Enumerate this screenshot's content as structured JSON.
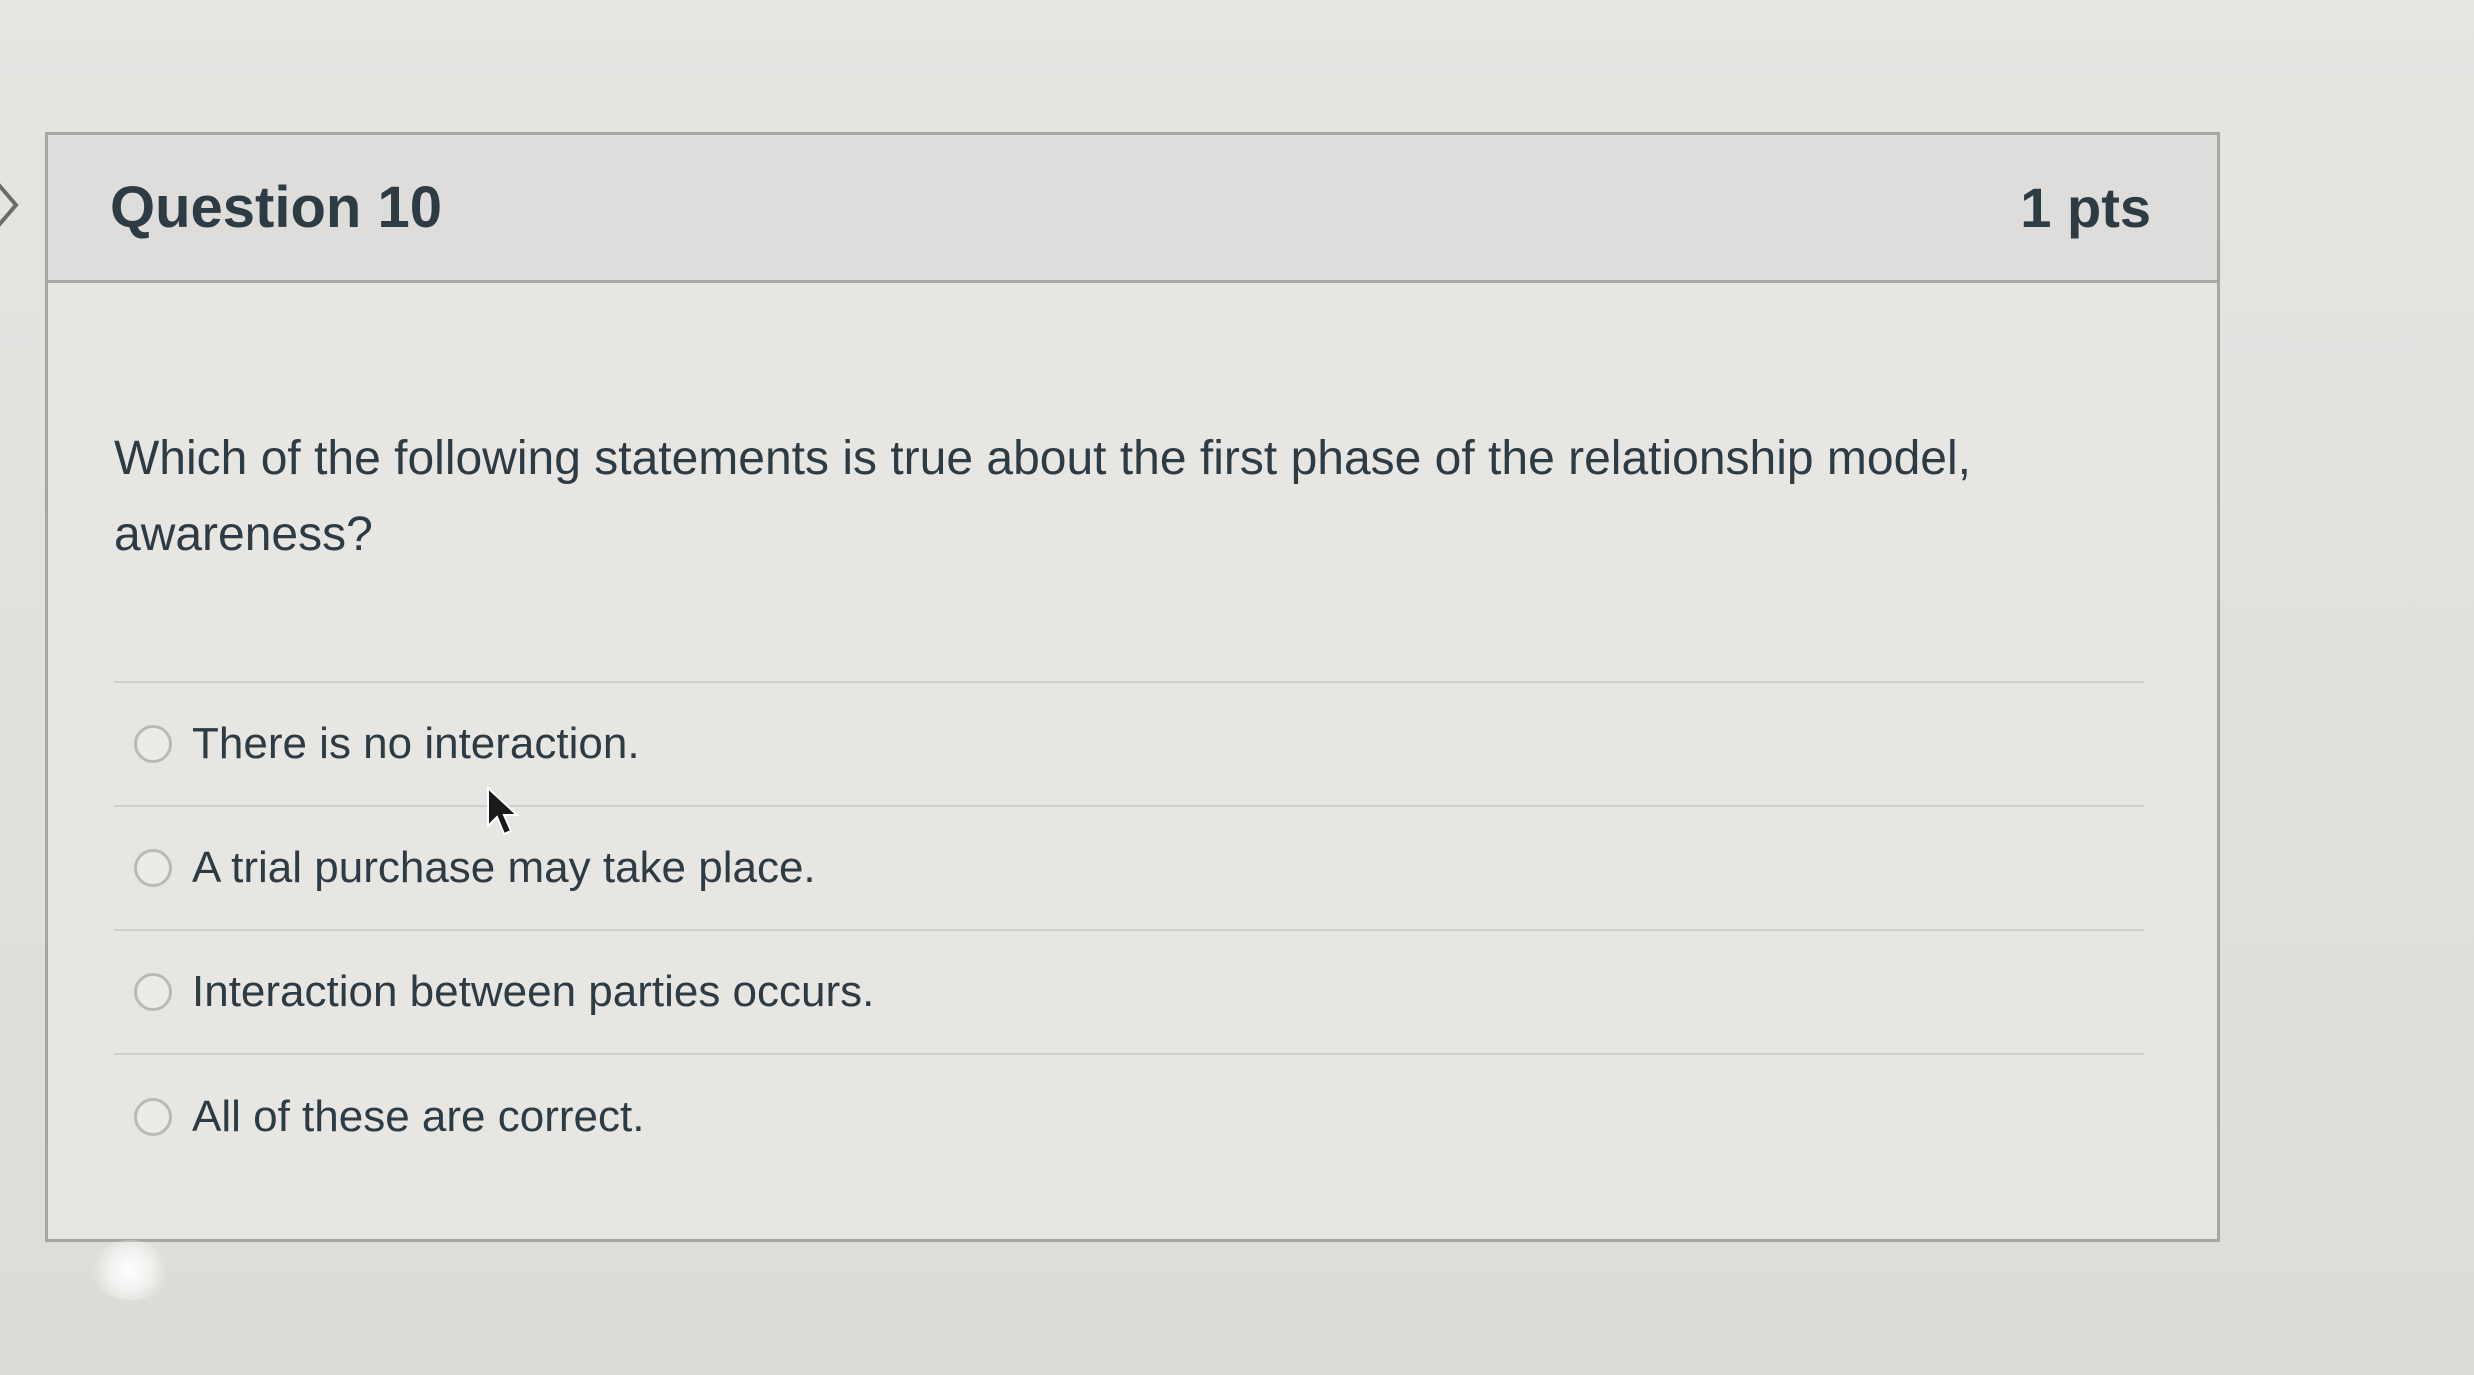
{
  "question": {
    "title": "Question 10",
    "points": "1 pts",
    "text": "Which of the following statements is true about the first phase of the relationship model, awareness?"
  },
  "answers": [
    {
      "label": "There is no interaction.",
      "selected": false
    },
    {
      "label": "A trial purchase may take place.",
      "selected": false
    },
    {
      "label": "Interaction between parties occurs.",
      "selected": false
    },
    {
      "label": "All of these are correct.",
      "selected": false
    }
  ],
  "icons": {
    "nav": "chevron-right-icon",
    "pointer": "mouse-cursor-icon"
  },
  "colors": {
    "text": "#2d3b45",
    "border": "#a6a6a3",
    "background": "#e6e5e2"
  }
}
